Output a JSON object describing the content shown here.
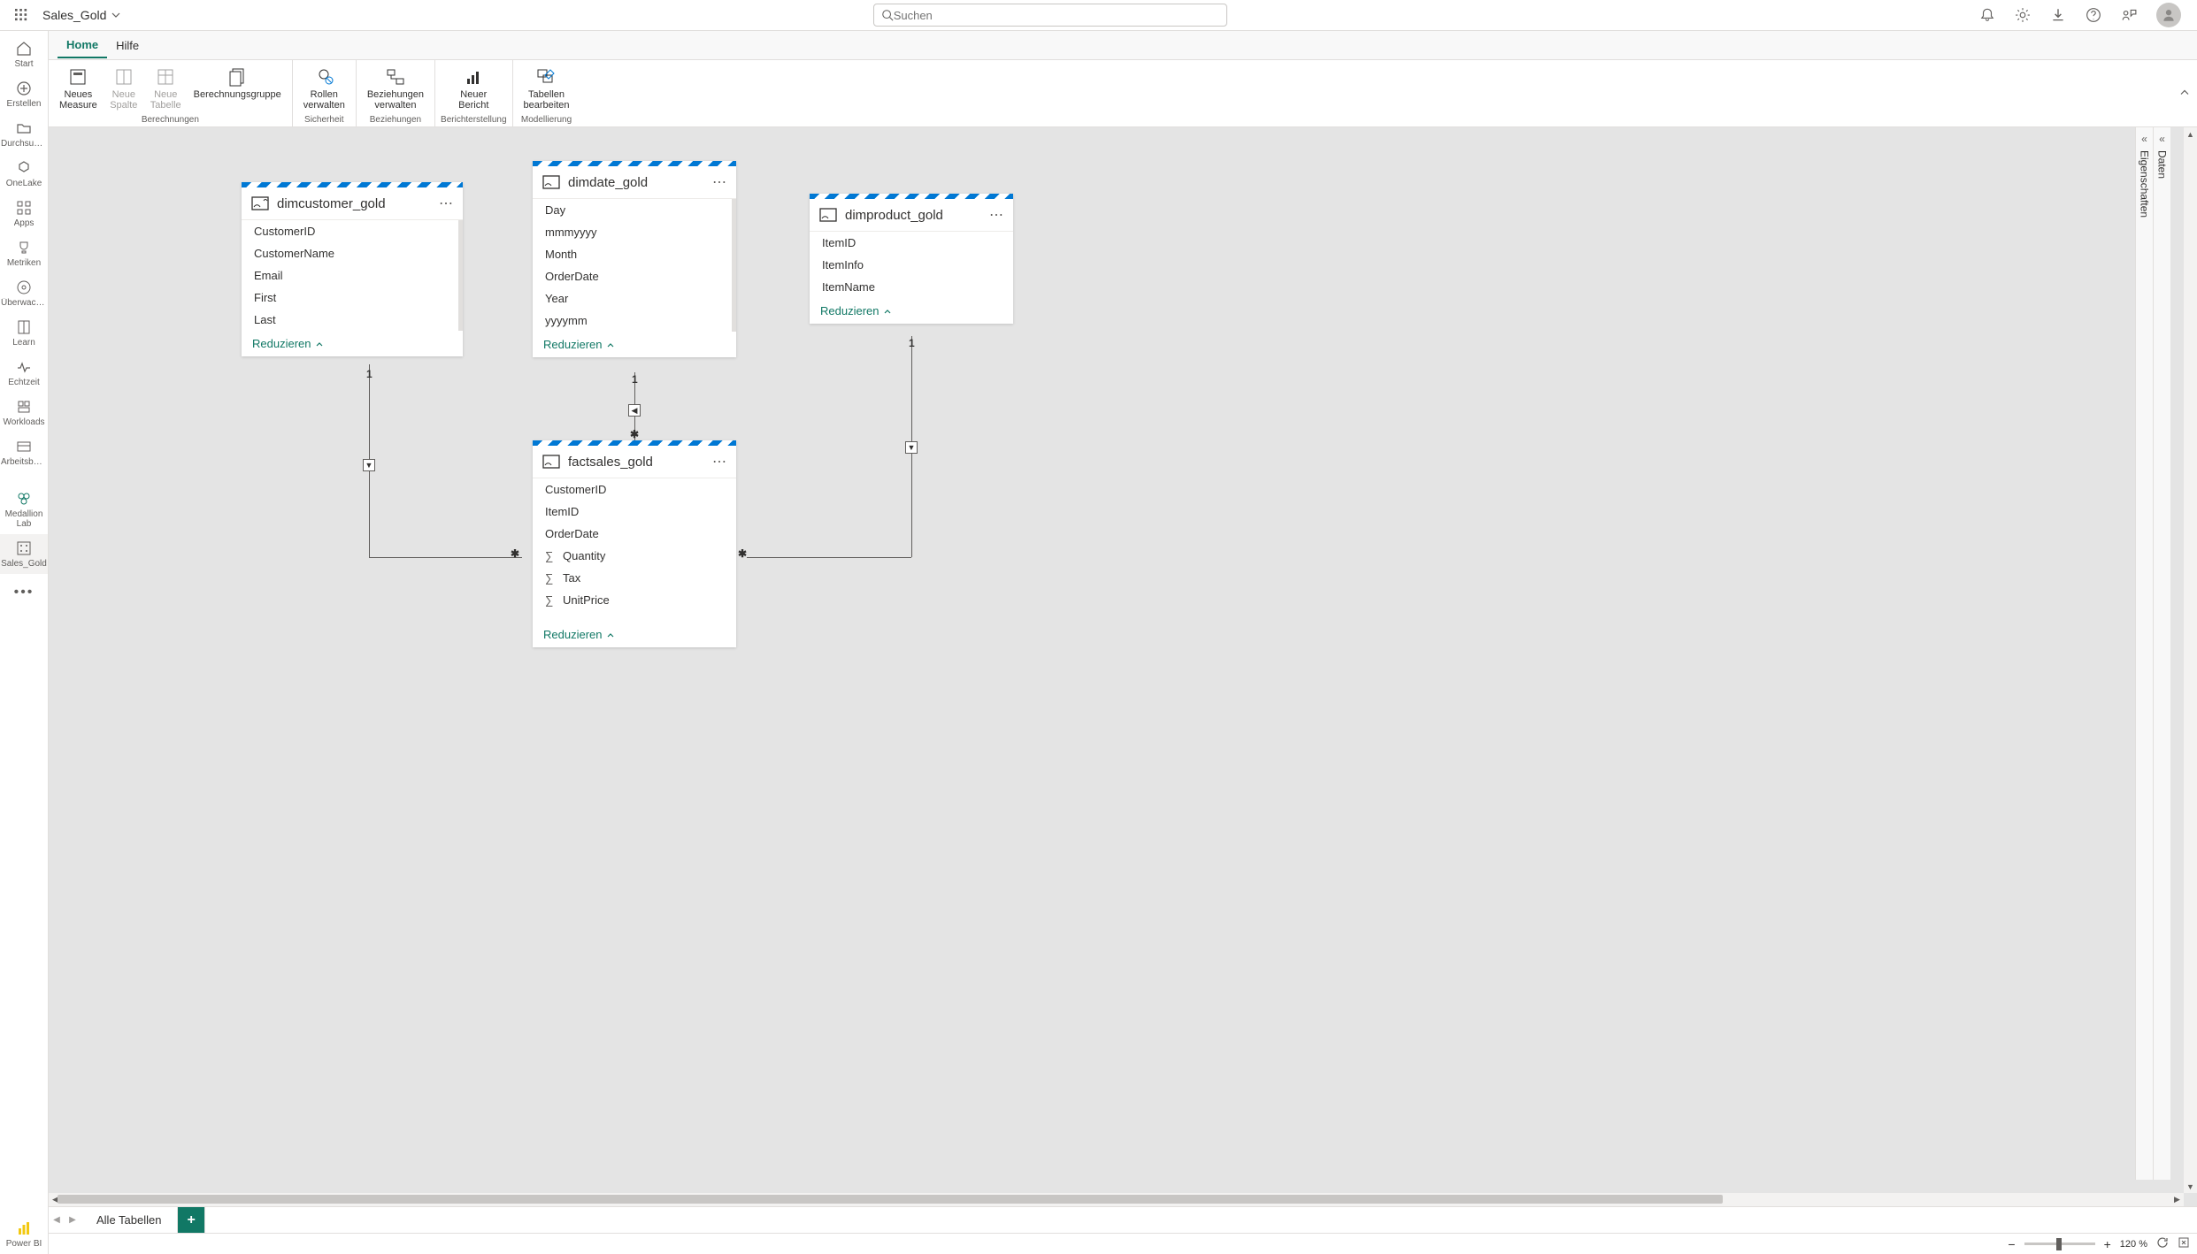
{
  "app": {
    "title": "Sales_Gold",
    "search_placeholder": "Suchen"
  },
  "rail": {
    "start": "Start",
    "create": "Erstellen",
    "browse": "Durchsuchen",
    "onelake": "OneLake",
    "apps": "Apps",
    "metrics": "Metriken",
    "monitor": "Überwachung",
    "learn": "Learn",
    "realtime": "Echtzeit",
    "workloads": "Workloads",
    "workspaces": "Arbeitsberei…",
    "medallion": "Medallion Lab",
    "salesgold": "Sales_Gold",
    "powerbi": "Power BI"
  },
  "tabs": {
    "home": "Home",
    "help": "Hilfe"
  },
  "ribbon": {
    "calc_group": "Berechnungen",
    "new_measure": "Neues\nMeasure",
    "new_column": "Neue\nSpalte",
    "new_table": "Neue\nTabelle",
    "calc_group_btn": "Berechnungsgruppe",
    "security_group": "Sicherheit",
    "manage_roles": "Rollen\nverwalten",
    "rel_group": "Beziehungen",
    "manage_rel": "Beziehungen\nverwalten",
    "report_group": "Berichterstellung",
    "new_report": "Neuer\nBericht",
    "model_group": "Modellierung",
    "edit_tables": "Tabellen\nbearbeiten"
  },
  "cards": {
    "dimcustomer": {
      "title": "dimcustomer_gold",
      "f0": "CustomerID",
      "f1": "CustomerName",
      "f2": "Email",
      "f3": "First",
      "f4": "Last"
    },
    "dimdate": {
      "title": "dimdate_gold",
      "f0": "Day",
      "f1": "mmmyyyy",
      "f2": "Month",
      "f3": "OrderDate",
      "f4": "Year",
      "f5": "yyyymm"
    },
    "dimproduct": {
      "title": "dimproduct_gold",
      "f0": "ItemID",
      "f1": "ItemInfo",
      "f2": "ItemName"
    },
    "factsales": {
      "title": "factsales_gold",
      "f0": "CustomerID",
      "f1": "ItemID",
      "f2": "OrderDate",
      "f3": "Quantity",
      "f4": "Tax",
      "f5": "UnitPrice"
    },
    "collapse": "Reduzieren"
  },
  "panes": {
    "data": "Daten",
    "props": "Eigenschaften"
  },
  "bottom": {
    "all_tables": "Alle Tabellen"
  },
  "status": {
    "zoom": "120 %"
  }
}
